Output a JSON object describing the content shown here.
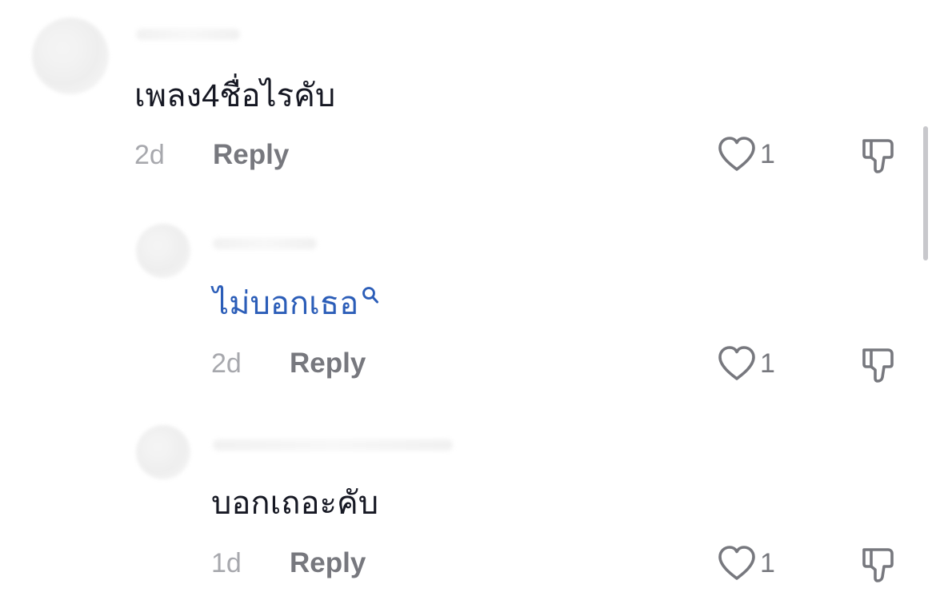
{
  "comments": [
    {
      "text": "เพลง4ชื่อไรคับ",
      "time": "2d",
      "reply_label": "Reply",
      "likes": "1",
      "is_link": false
    },
    {
      "text": "ไม่บอกเธอ",
      "time": "2d",
      "reply_label": "Reply",
      "likes": "1",
      "is_link": true
    },
    {
      "text": "บอกเถอะคับ",
      "time": "1d",
      "reply_label": "Reply",
      "likes": "1",
      "is_link": false
    }
  ],
  "icons": {
    "like": "heart-outline-icon",
    "dislike": "thumbs-down-icon",
    "search": "search-icon"
  },
  "colors": {
    "text": "#161823",
    "link": "#2b5db8",
    "meta": "#a7a8ad",
    "action": "#77787e"
  }
}
